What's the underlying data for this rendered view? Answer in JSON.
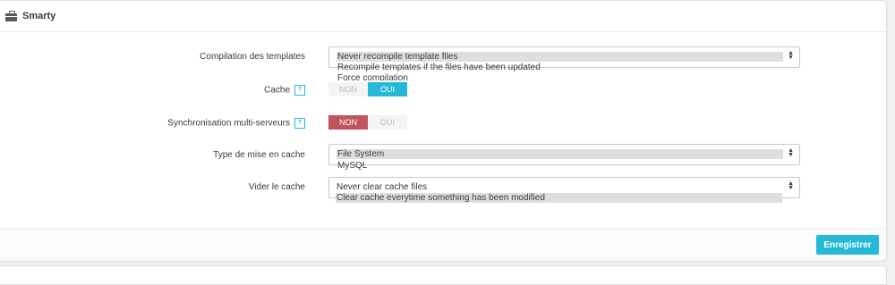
{
  "panel": {
    "title": "Smarty",
    "icon": "briefcase-icon"
  },
  "fields": {
    "compilation": {
      "label": "Compilation des templates",
      "options": [
        "Never recompile template files",
        "Recompile templates if the files have been updated",
        "Force compilation"
      ],
      "selected": "Never recompile template files"
    },
    "cache": {
      "label": "Cache",
      "help": "?",
      "off_label": "NON",
      "on_label": "OUI",
      "value": "OUI"
    },
    "multi_server": {
      "label": "Synchronisation multi-serveurs",
      "help": "?",
      "off_label": "NON",
      "on_label": "OUI",
      "value": "NON"
    },
    "cache_type": {
      "label": "Type de mise en cache",
      "options": [
        "File System",
        "MySQL"
      ],
      "selected": "File System"
    },
    "clear_cache": {
      "label": "Vider le cache",
      "options": [
        "Never clear cache files",
        "Clear cache everytime something has been modified"
      ],
      "selected": "Clear cache everytime something has been modified"
    }
  },
  "footer": {
    "save_label": "Enregistrer"
  },
  "colors": {
    "accent": "#25b9d7",
    "danger": "#c0555e"
  }
}
